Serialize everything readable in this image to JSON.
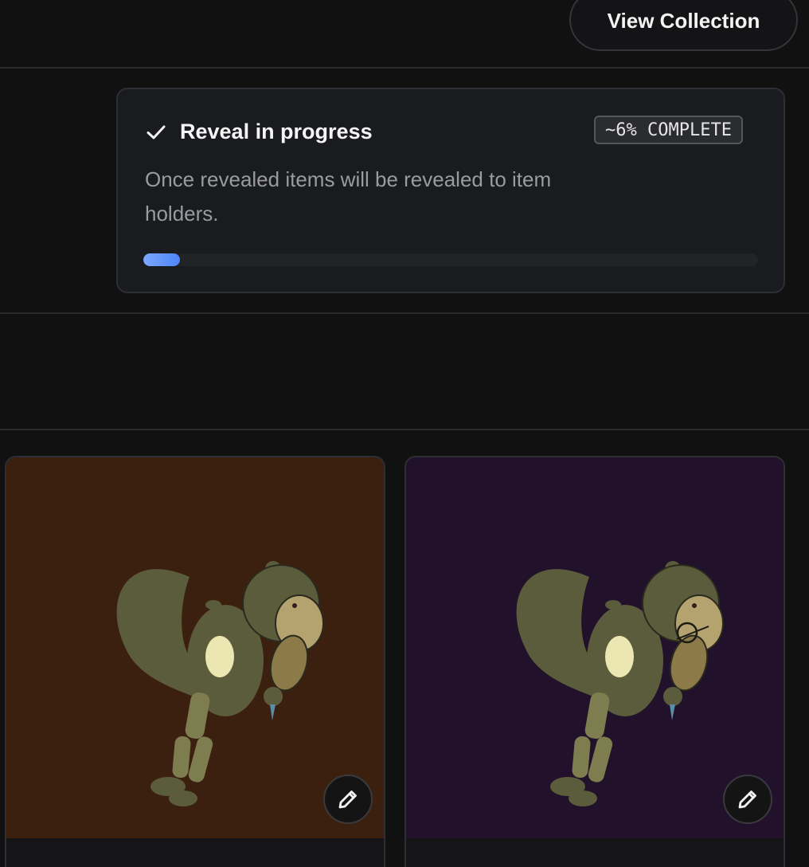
{
  "header": {
    "view_collection_label": "View Collection"
  },
  "reveal": {
    "title": "Reveal in progress",
    "badge": "~6% COMPLETE",
    "description": "Once revealed items will be revealed to item holders.",
    "progress_fraction": 0.06
  },
  "items": [
    {
      "background_color": "#3b2010",
      "icon": "pencil-icon"
    },
    {
      "background_color": "#21112a",
      "icon": "pencil-icon"
    }
  ],
  "colors": {
    "accent": "#4e86f7",
    "card_border": "#2e2f34"
  }
}
